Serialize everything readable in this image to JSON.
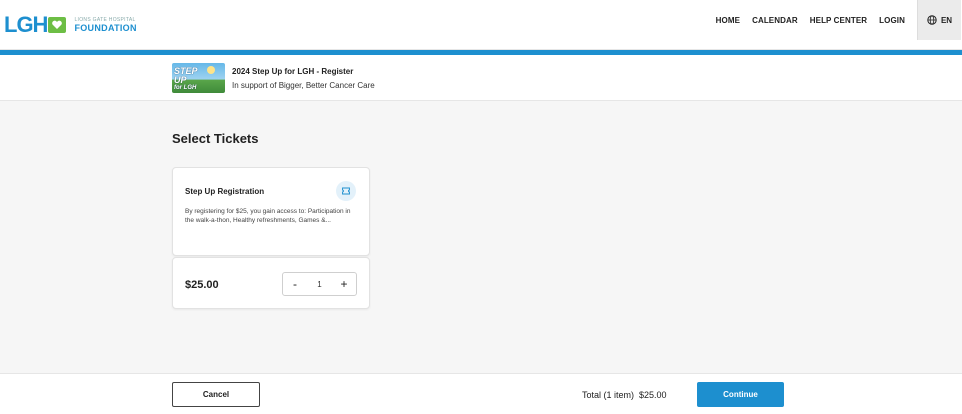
{
  "header": {
    "logo_mark": "LGH",
    "logo_small": "LIONS GATE HOSPITAL",
    "logo_big": "FOUNDATION",
    "nav": [
      "HOME",
      "CALENDAR",
      "HELP CENTER",
      "LOGIN"
    ],
    "language": "EN",
    "language_icon": "globe-icon",
    "accent_color": "#1d8fcf"
  },
  "event": {
    "thumb_text": [
      "STEP",
      "UP",
      "for LGH"
    ],
    "title": "2024 Step Up for LGH - Register",
    "subtitle": "In support of Bigger, Better Cancer Care"
  },
  "main": {
    "section_title": "Select Tickets",
    "ticket": {
      "name": "Step Up Registration",
      "icon": "ticket-icon",
      "description": "By registering for $25, you gain access to: Participation in the walk-a-thon, Healthy refreshments, Games &...",
      "price": "$25.00",
      "minus": "-",
      "quantity": "1",
      "plus": "+"
    }
  },
  "footer": {
    "cancel_label": "Cancel",
    "total_label": "Total (1 item)",
    "total_value": "$25.00",
    "continue_label": "Continue"
  }
}
